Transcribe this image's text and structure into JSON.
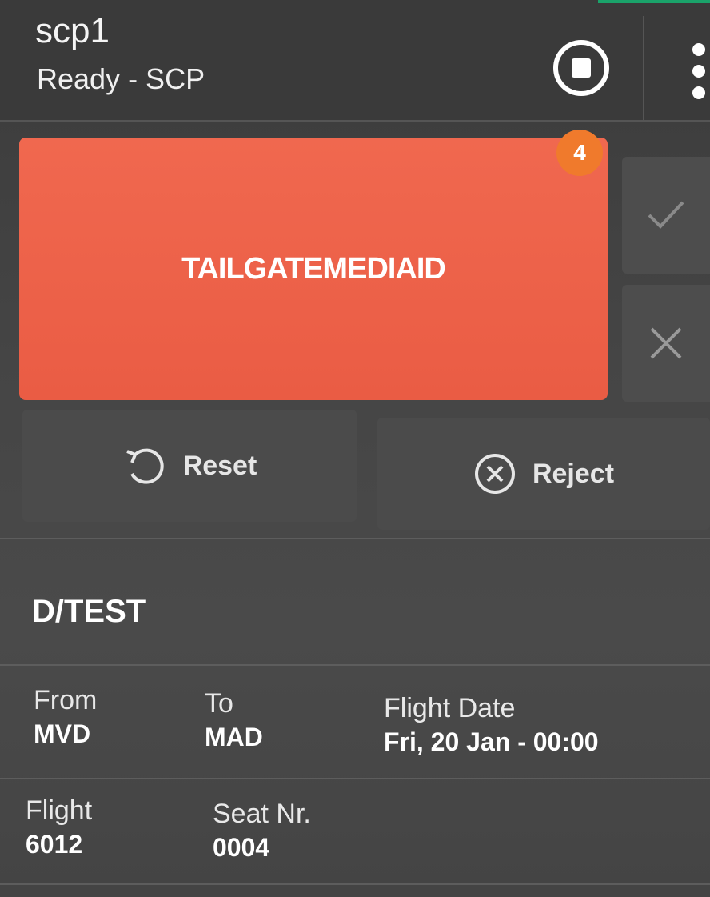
{
  "header": {
    "title": "scp1",
    "status": "Ready - SCP",
    "stop_icon": "stop-circle-icon",
    "more_icon": "more-vertical-icon"
  },
  "alert": {
    "text": "TAILGATEMEDIAID",
    "badge_count": "4",
    "color": "#ea5c44",
    "badge_color": "#f07a2c"
  },
  "side_actions": {
    "accept_icon": "check-icon",
    "dismiss_icon": "close-icon"
  },
  "actions": {
    "reset_label": "Reset",
    "reset_icon": "reset-icon",
    "reject_label": "Reject",
    "reject_icon": "reject-circle-x-icon"
  },
  "passenger": {
    "name": "D/TEST",
    "from_label": "From",
    "from_value": "MVD",
    "to_label": "To",
    "to_value": "MAD",
    "date_label": "Flight Date",
    "date_value": "Fri, 20 Jan - 00:00",
    "flight_label": "Flight",
    "flight_value": "6012",
    "seat_label": "Seat Nr.",
    "seat_value": "0004"
  }
}
